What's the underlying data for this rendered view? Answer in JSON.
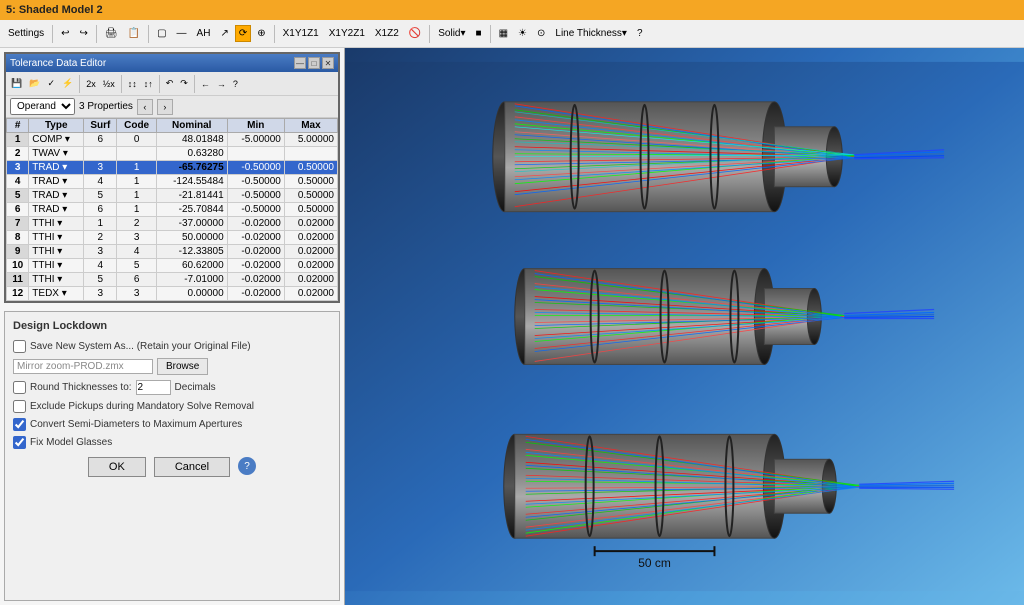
{
  "titlebar": {
    "title": "5: Shaded Model 2"
  },
  "main_toolbar": {
    "items": [
      "Settings",
      "X1Y1Z1",
      "X1Y2Z1",
      "X1Z2",
      "Solid",
      "Line Thickness"
    ]
  },
  "tde": {
    "title": "Tolerance Data Editor",
    "win_btns": [
      "—",
      "□",
      "✕"
    ],
    "toolbar_btns": [
      "💾",
      "📂",
      "✓",
      "⚡",
      "2x",
      "1/2X",
      "↕↕",
      "↕↑",
      "↶",
      "↷",
      "←",
      "→",
      "?"
    ],
    "operand_label": "Operand",
    "properties_label": "3 Properties",
    "columns": [
      "#",
      "Type",
      "Surf",
      "Code",
      "Nominal",
      "Min",
      "Max"
    ],
    "rows": [
      {
        "num": "1",
        "type": "COMP",
        "surf": "6",
        "code": "0",
        "nominal": "48.01848",
        "min": "-5.00000",
        "max": "5.00000"
      },
      {
        "num": "2",
        "type": "TWAV",
        "surf": "",
        "code": "",
        "nominal": "0.63280",
        "min": "",
        "max": ""
      },
      {
        "num": "3",
        "type": "TRAD",
        "surf": "3",
        "code": "1",
        "nominal": "-65.76275",
        "min": "-0.50000",
        "max": "0.50000"
      },
      {
        "num": "4",
        "type": "TRAD",
        "surf": "4",
        "code": "1",
        "nominal": "-124.55484",
        "min": "-0.50000",
        "max": "0.50000"
      },
      {
        "num": "5",
        "type": "TRAD",
        "surf": "5",
        "code": "1",
        "nominal": "-21.81441",
        "min": "-0.50000",
        "max": "0.50000"
      },
      {
        "num": "6",
        "type": "TRAD",
        "surf": "6",
        "code": "1",
        "nominal": "-25.70844",
        "min": "-0.50000",
        "max": "0.50000"
      },
      {
        "num": "7",
        "type": "TTHI",
        "surf": "1",
        "code": "2",
        "nominal": "-37.00000",
        "min": "-0.02000",
        "max": "0.02000"
      },
      {
        "num": "8",
        "type": "TTHI",
        "surf": "2",
        "code": "3",
        "nominal": "50.00000",
        "min": "-0.02000",
        "max": "0.02000"
      },
      {
        "num": "9",
        "type": "TTHI",
        "surf": "3",
        "code": "4",
        "nominal": "-12.33805",
        "min": "-0.02000",
        "max": "0.02000"
      },
      {
        "num": "10",
        "type": "TTHI",
        "surf": "4",
        "code": "5",
        "nominal": "60.62000",
        "min": "-0.02000",
        "max": "0.02000"
      },
      {
        "num": "11",
        "type": "TTHI",
        "surf": "5",
        "code": "6",
        "nominal": "-7.01000",
        "min": "-0.02000",
        "max": "0.02000"
      },
      {
        "num": "12",
        "type": "TEDX",
        "surf": "3",
        "code": "3",
        "nominal": "0.00000",
        "min": "-0.02000",
        "max": "0.02000"
      }
    ],
    "selected_row": 3,
    "highlighted_cell": {
      "row": 3,
      "col": "nominal"
    }
  },
  "design_lockdown": {
    "title": "Design Lockdown",
    "save_new_system_label": "Save New System As... (Retain your Original File)",
    "save_new_system_checked": false,
    "filename_value": "Mirror zoom-PROD.zmx",
    "browse_label": "Browse",
    "round_thicknesses_label": "Round Thicknesses to:",
    "round_thicknesses_checked": false,
    "round_decimals_value": "2",
    "decimals_label": "Decimals",
    "exclude_pickups_label": "Exclude Pickups during Mandatory Solve Removal",
    "exclude_pickups_checked": false,
    "convert_semi_label": "Convert Semi-Diameters to Maximum Apertures",
    "convert_semi_checked": true,
    "fix_model_label": "Fix Model Glasses",
    "fix_model_checked": true,
    "ok_label": "OK",
    "cancel_label": "Cancel",
    "help_label": "?"
  },
  "viewport": {
    "scale_label": "50 cm"
  }
}
